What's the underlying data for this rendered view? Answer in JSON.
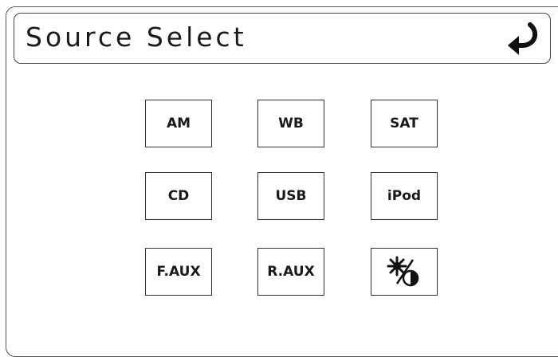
{
  "header": {
    "title": "Source Select",
    "back_icon": "return-arrow-icon"
  },
  "sources": [
    {
      "label": "AM"
    },
    {
      "label": "WB"
    },
    {
      "label": "SAT"
    },
    {
      "label": "CD"
    },
    {
      "label": "USB"
    },
    {
      "label": "iPod"
    },
    {
      "label": "F.AUX"
    },
    {
      "label": "R.AUX"
    }
  ],
  "display_settings": {
    "icon": "brightness-contrast-icon"
  }
}
